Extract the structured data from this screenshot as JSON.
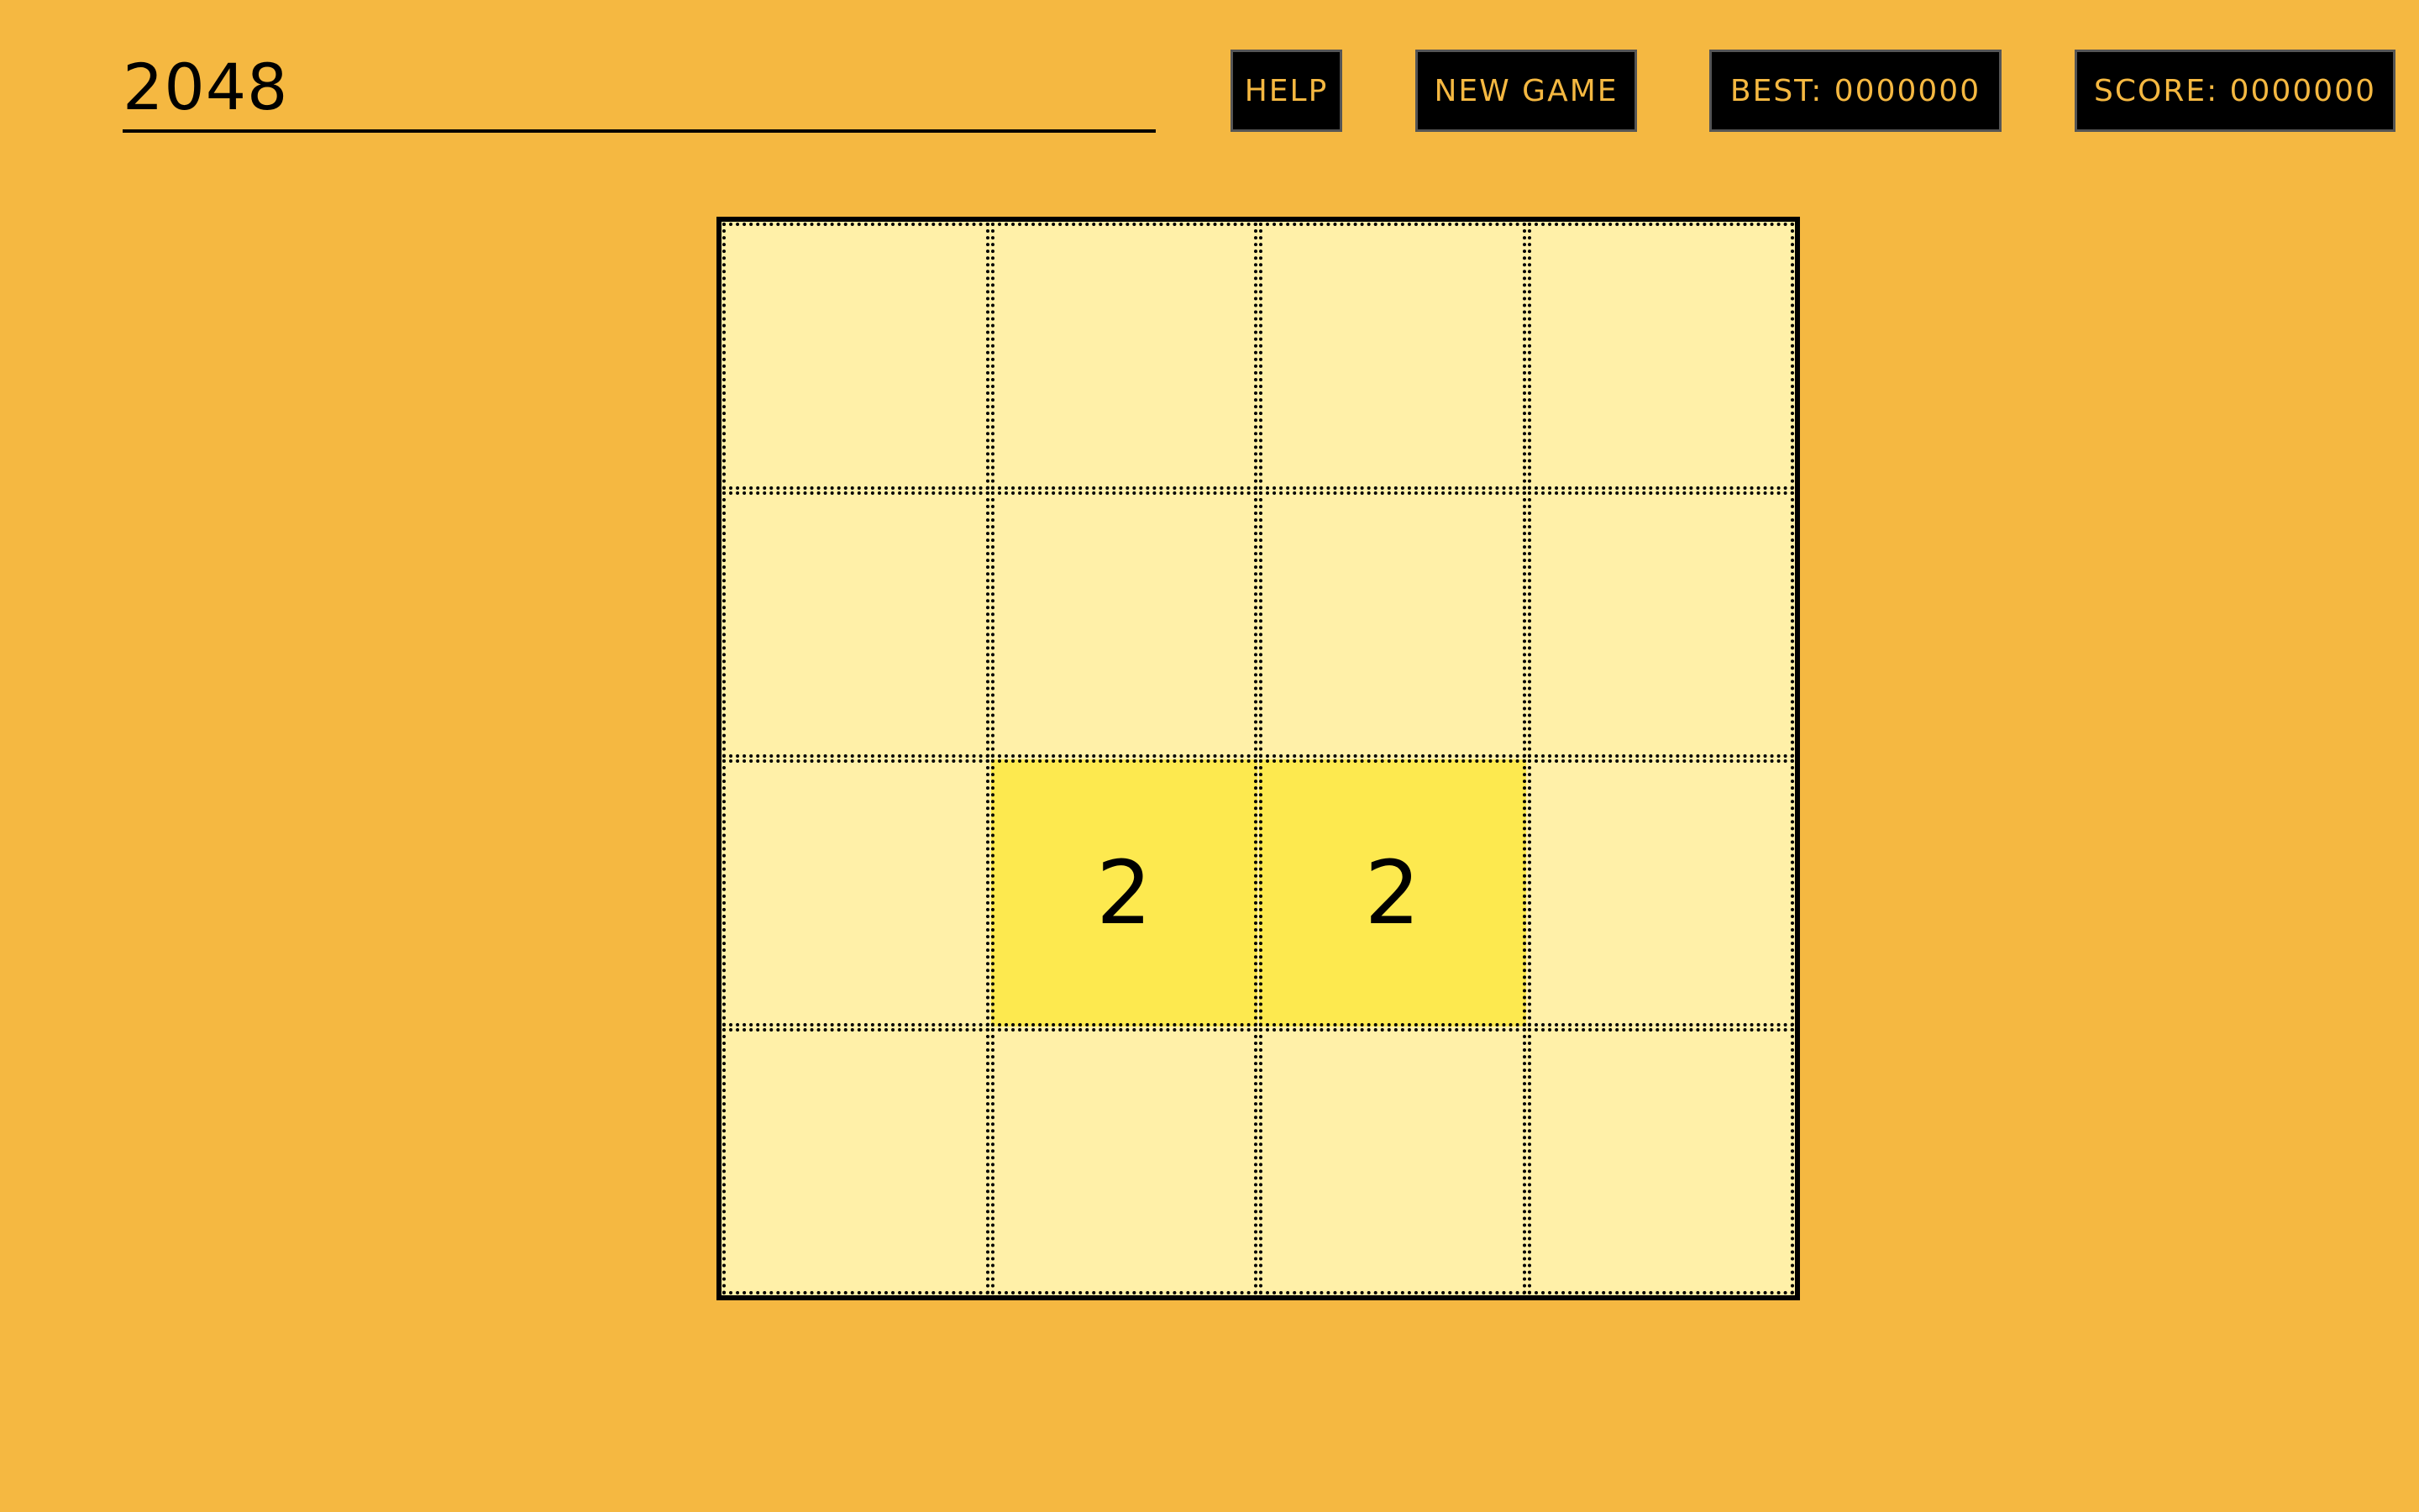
{
  "header": {
    "title": "2048",
    "help_label": "HELP",
    "new_game_label": "NEW GAME",
    "best_label": "BEST: 0000000",
    "score_label": "SCORE: 0000000"
  },
  "board": {
    "cells": [
      [
        "",
        "",
        "",
        ""
      ],
      [
        "",
        "",
        "",
        ""
      ],
      [
        "",
        "2",
        "2",
        ""
      ],
      [
        "",
        "",
        "",
        ""
      ]
    ]
  },
  "colors": {
    "background": "#f5b841",
    "empty_tile": "#fff0a8",
    "tile_2": "#fde94f",
    "button_bg": "#000000",
    "button_text": "#f5b841"
  }
}
